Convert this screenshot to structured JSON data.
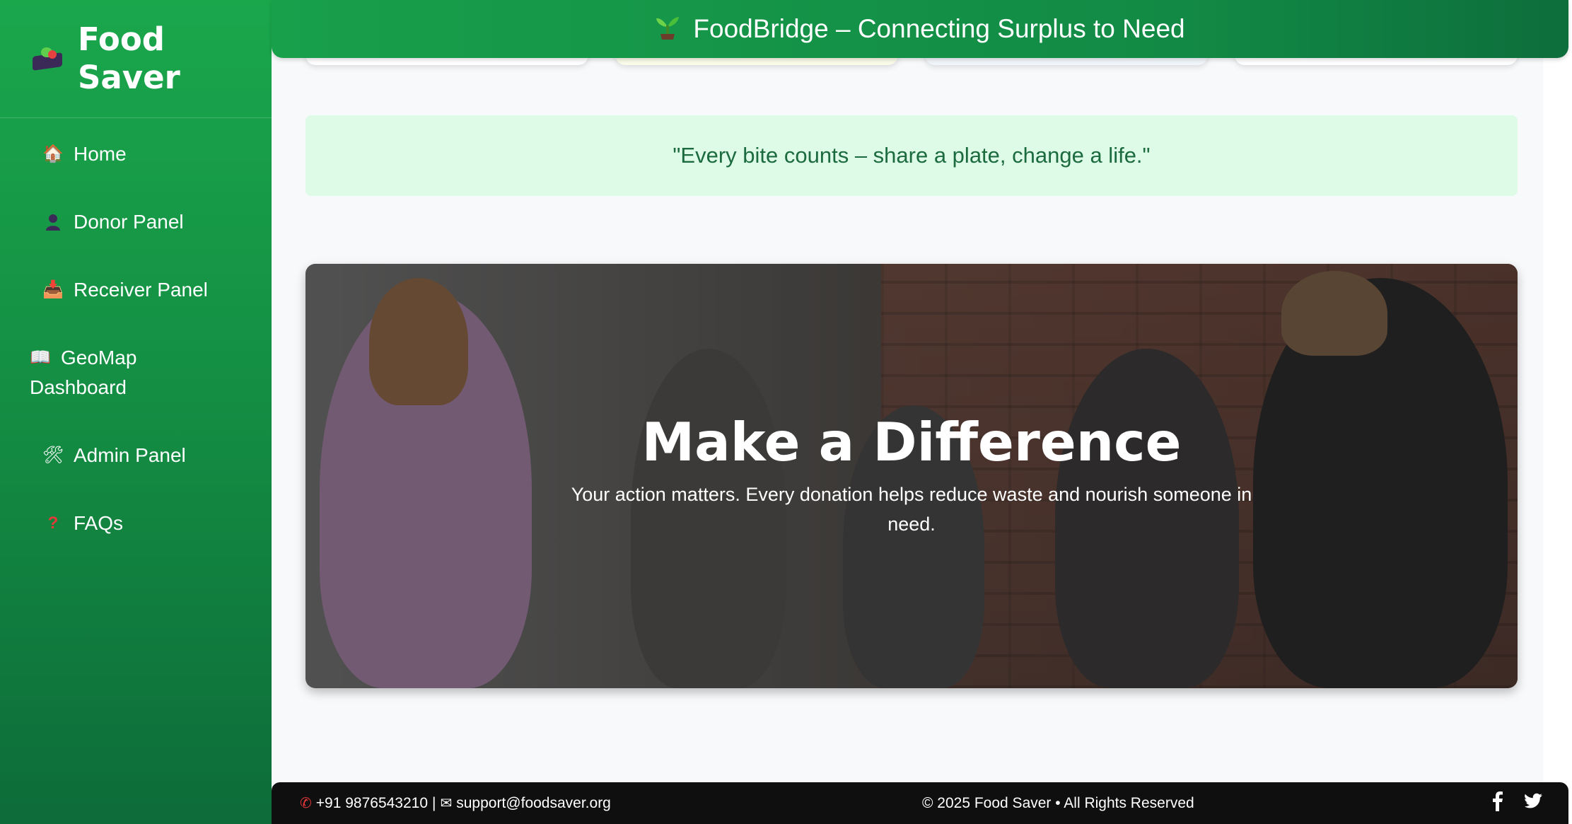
{
  "sidebar": {
    "brand": {
      "line1": "Food",
      "line2": "Saver"
    },
    "items": [
      {
        "label": "Home",
        "icon": "house-icon"
      },
      {
        "label": "Donor Panel",
        "icon": "person-icon"
      },
      {
        "label": "Receiver Panel",
        "icon": "inbox-icon"
      },
      {
        "label_line1": "GeoMap",
        "label_line2": "Dashboard",
        "icon": "map-icon"
      },
      {
        "label": "Admin Panel",
        "icon": "tools-icon"
      },
      {
        "label": "FAQs",
        "icon": "question-icon"
      }
    ]
  },
  "header": {
    "title": "FoodBridge – Connecting Surplus to Need",
    "icon": "sprout-icon"
  },
  "quote": {
    "text": "\"Every bite counts – share a plate, change a life.\""
  },
  "hero": {
    "title": "Make a Difference",
    "subtitle": "Your action matters. Every donation helps reduce waste and nourish someone in need."
  },
  "footer": {
    "phone": "+91 9876543210",
    "separator": "|",
    "email": "support@foodsaver.org",
    "copyright": "© 2025 Food Saver • All Rights Reserved"
  },
  "colors": {
    "sidebar_green": "#1aa74c",
    "quote_bg": "#ddfbe7",
    "quote_text": "#1c6b3f",
    "footer_bg": "#0f0f0f"
  }
}
